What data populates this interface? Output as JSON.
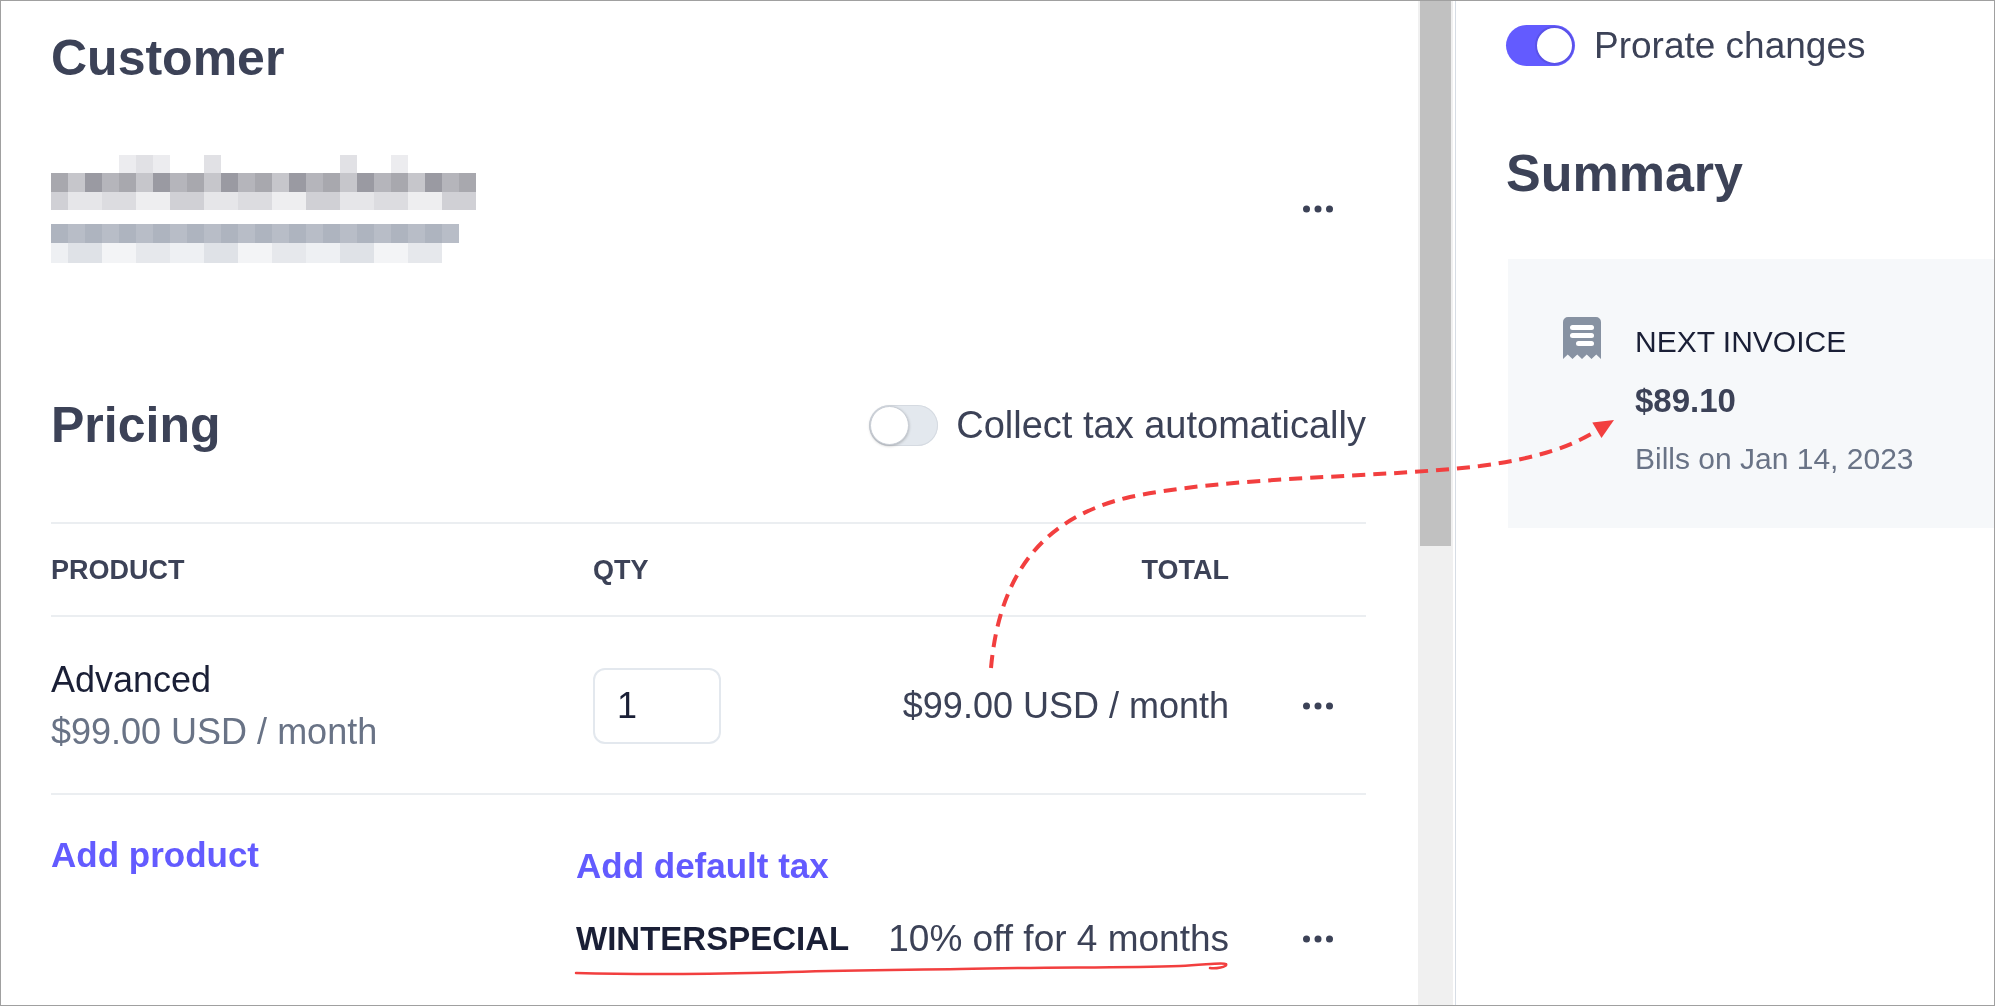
{
  "customer": {
    "title": "Customer"
  },
  "pricing": {
    "title": "Pricing",
    "collect_tax": {
      "label": "Collect tax automatically",
      "on": false
    },
    "table": {
      "columns": [
        "PRODUCT",
        "QTY",
        "TOTAL"
      ],
      "rows": [
        {
          "product": "Advanced",
          "price": "$99.00 USD / month",
          "qty": "1",
          "total": "$99.00 USD / month"
        }
      ]
    },
    "add_product": "Add product",
    "add_default_tax": "Add default tax",
    "discount": {
      "code": "WINTERSPECIAL",
      "description": "10% off for 4 months"
    }
  },
  "prorate": {
    "label": "Prorate changes",
    "on": true
  },
  "summary": {
    "title": "Summary",
    "next_invoice": {
      "label": "NEXT INVOICE",
      "amount": "$89.10",
      "date": "Bills on Jan 14, 2023"
    }
  }
}
